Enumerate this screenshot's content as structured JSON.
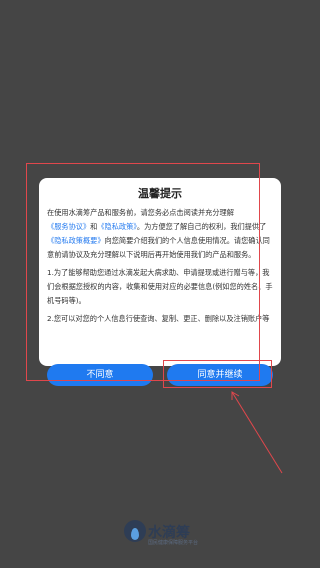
{
  "dialog": {
    "title": "温馨提示",
    "p1_a": "在使用水滴筹产品和服务前，请您务必点击阅读并充分理解",
    "p1_link1": "《服务协议》",
    "p1_b": "和",
    "p1_link2": "《隐私政策》",
    "p1_c": "。为方便您了解自己的权利，我们提供了",
    "p1_link3": "《隐私政策概要》",
    "p1_d": "向您简要介绍我们的个人信息使用情况。请您确认同意前请协议及充分理解以下说明后再开始使用我们的产品和服务。",
    "p2": "1.为了能够帮助您通过水滴发起大病求助、申请提现或进行赠与等，我们会根据您授权的内容，收集和使用对应的必要信息(例如您的姓名、手机号码等)。",
    "p3": "2.您可以对您的个人信息行使查询、复制、更正、删除以及注销账户等个人信息主体权利，您可以自行行使该等权利或直接与我们联系。个人信息保护事宜的联系方式可见文末）。",
    "disagree_label": "不同意",
    "agree_label": "同意并继续"
  },
  "branding": {
    "name": "水滴筹",
    "slogan": "国民健康保障服务平台"
  },
  "colors": {
    "accent": "#1f7af0",
    "annotation": "#e0474c"
  }
}
